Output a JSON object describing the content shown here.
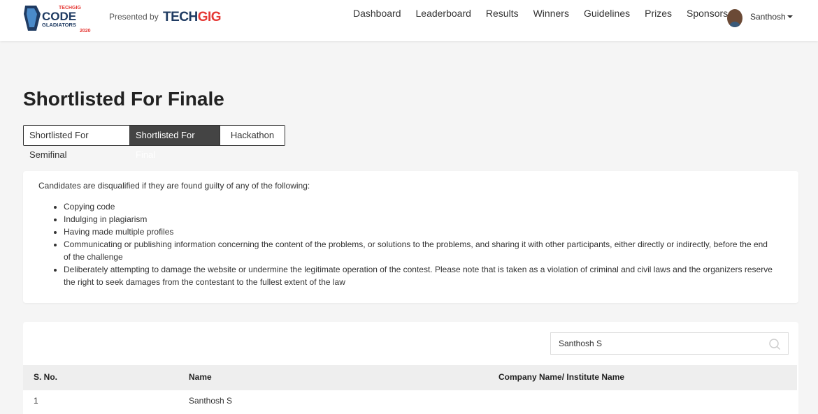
{
  "header": {
    "logo": {
      "top": "TECHGIG",
      "main": "CODE",
      "sub": "GLADIATORS",
      "year": "2020"
    },
    "presented_by": "Presented by",
    "brand_tech": "TECH",
    "brand_gig": "GIG",
    "nav": [
      "Dashboard",
      "Leaderboard",
      "Results",
      "Winners",
      "Guidelines",
      "Prizes",
      "Sponsors"
    ],
    "user": {
      "name": "Santhosh"
    }
  },
  "page": {
    "title": "Shortlisted For Finale"
  },
  "tabs": [
    {
      "label": "Shortlisted For Semifinal",
      "active": false
    },
    {
      "label": "Shortlisted For Final",
      "active": true
    },
    {
      "label": "Hackathon",
      "active": false
    }
  ],
  "rules": {
    "intro": "Candidates are disqualified if they are found guilty of any of the following:",
    "items": [
      "Copying code",
      "Indulging in plagiarism",
      "Having made multiple profiles",
      "Communicating or publishing information concerning the content of the problems, or solutions to the problems, and sharing it with other participants, either directly or indirectly, before the end of the challenge",
      "Deliberately attempting to damage the website or undermine the legitimate operation of the contest. Please note that is taken as a violation of criminal and civil laws and the organizers reserve the right to seek damages from the contestant to the fullest extent of the law"
    ]
  },
  "search": {
    "value": "Santhosh S"
  },
  "table": {
    "headers": [
      "S. No.",
      "Name",
      "Company Name/ Institute Name"
    ],
    "rows": [
      [
        "1",
        "Santhosh S",
        ""
      ]
    ]
  },
  "colors": {
    "accent_dark": "#444444",
    "brand_blue": "#1f3b62",
    "brand_red": "#e53935"
  }
}
